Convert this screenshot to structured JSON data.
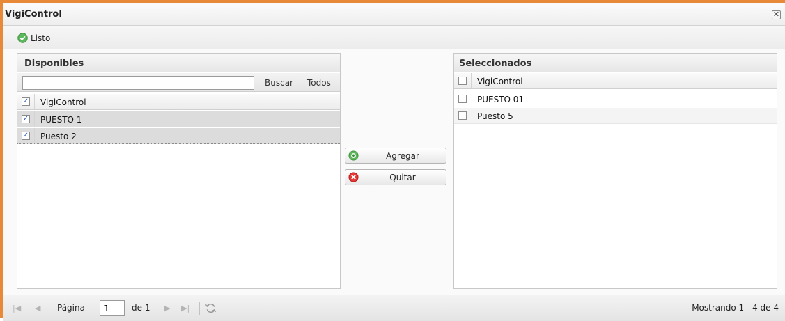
{
  "window": {
    "title": "VigiControl",
    "close_glyph": "✕"
  },
  "status": {
    "icon": "check-circle-icon",
    "text": "Listo",
    "color": "#4caf50"
  },
  "available": {
    "title": "Disponibles",
    "search_value": "",
    "search_label": "Buscar",
    "all_label": "Todos",
    "column_header": "VigiControl",
    "header_checked": true,
    "rows": [
      {
        "label": "PUESTO 1",
        "checked": true
      },
      {
        "label": "Puesto 2",
        "checked": true
      }
    ]
  },
  "actions": {
    "add_label": "Agregar",
    "add_icon": "plus-circle-icon",
    "add_color": "#4caf50",
    "remove_label": "Quitar",
    "remove_icon": "x-circle-icon",
    "remove_color": "#e53935"
  },
  "selected": {
    "title": "Seleccionados",
    "column_header": "VigiControl",
    "header_checked": false,
    "rows": [
      {
        "label": "PUESTO 01",
        "checked": false
      },
      {
        "label": "Puesto 5",
        "checked": false
      }
    ]
  },
  "pager": {
    "page_label": "Página",
    "page_value": "1",
    "of_label": "de 1",
    "summary": "Mostrando 1 - 4 de 4"
  },
  "colors": {
    "frame_accent": "#e8893a"
  }
}
